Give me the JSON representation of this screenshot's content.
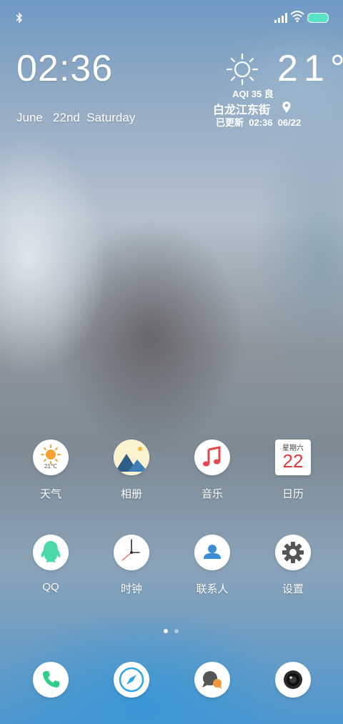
{
  "clock": {
    "time": "02:36",
    "date": "June   22nd  Saturday"
  },
  "weather": {
    "temperature": "21°",
    "aqi": "AQI 35 良",
    "location": "白龙江东街",
    "updated": "已更新  02:36  06/22"
  },
  "apps": [
    {
      "label": "天气",
      "badge": "21℃"
    },
    {
      "label": "相册"
    },
    {
      "label": "音乐"
    },
    {
      "label": "日历",
      "weekday": "星期六",
      "day": "22"
    },
    {
      "label": "QQ"
    },
    {
      "label": "时钟"
    },
    {
      "label": "联系人"
    },
    {
      "label": "设置"
    }
  ],
  "page_indicator": {
    "current": 1,
    "total": 2
  },
  "dock": [
    {
      "icon": "phone-icon"
    },
    {
      "icon": "browser-icon"
    },
    {
      "icon": "messages-icon"
    },
    {
      "icon": "camera-icon"
    }
  ],
  "colors": {
    "battery": "#59e3c8",
    "calendar_red": "#e03a3a",
    "qq_green": "#4cd9a8",
    "phone_green": "#2dcf88"
  }
}
